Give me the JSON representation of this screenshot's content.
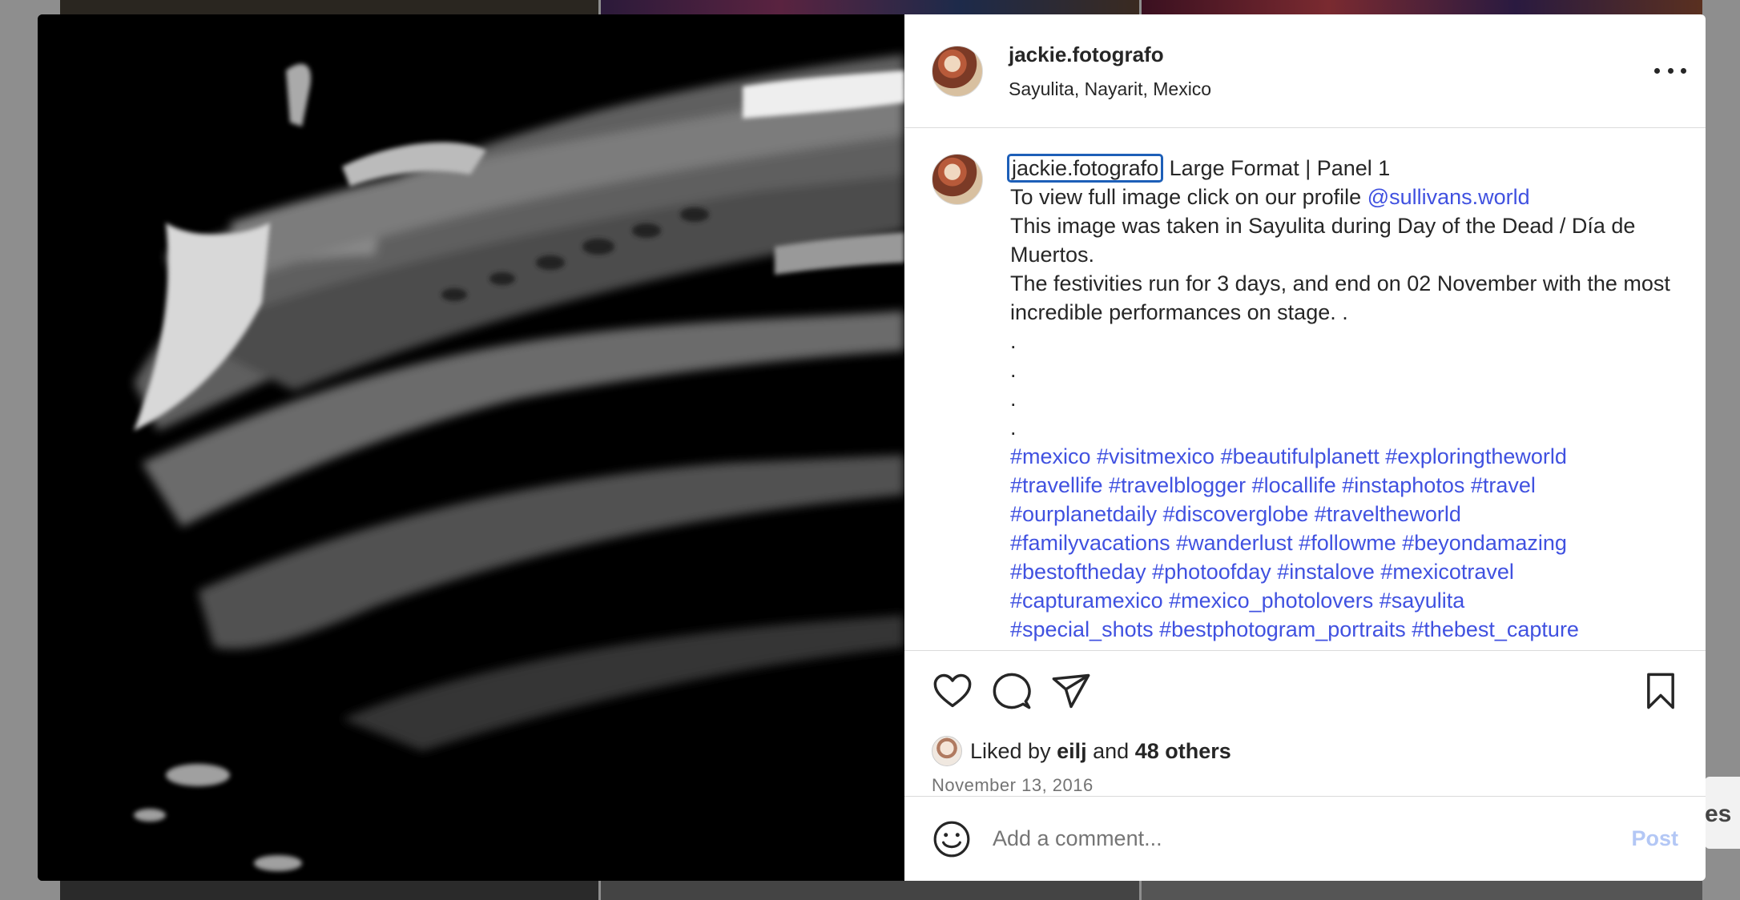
{
  "post": {
    "username": "jackie.fotografo",
    "location": "Sayulita, Nayarit, Mexico",
    "caption": {
      "username": "jackie.fotografo",
      "title": "Large Format | Panel 1",
      "line2_prefix": "To view full image click on our profile",
      "mention": "@sullivans.world",
      "line3": "This image was taken in Sayulita during Day of the Dead / Día de Muertos.",
      "line4": "The festivities run for 3 days, and end on 02 November with the most incredible performances on stage. .",
      "dots": [
        ".",
        ".",
        ".",
        "."
      ],
      "hashtag_lines": [
        "#mexico #visitmexico #beautifulplanett #exploringtheworld",
        "#travellife #travelblogger #locallife #instaphotos #travel",
        "#ourplanetdaily #discoverglobe #traveltheworld",
        "#familyvacations #wanderlust #followme #beyondamazing",
        "#bestoftheday #photoofday #instalove #mexicotravel",
        "#capturamexico #mexico_photolovers #sayulita",
        "#special_shots #bestphotogram_portraits #thebest_capture"
      ]
    },
    "likes": {
      "prefix": "Liked by",
      "user": "eilj",
      "and": "and",
      "others": "48 others"
    },
    "date": "November 13, 2016",
    "comment": {
      "placeholder": "Add a comment...",
      "post_label": "Post"
    }
  },
  "icons": {
    "more": "more-horizontal-icon",
    "like": "heart-icon",
    "comment": "comment-bubble-icon",
    "share": "paper-plane-icon",
    "save": "bookmark-icon",
    "emoji": "smiley-icon"
  },
  "background": {
    "side_text": "es"
  },
  "colors": {
    "link": "#4051e0",
    "post_disabled": "#b3c7f5",
    "focus_outline": "#1d5fb8"
  }
}
